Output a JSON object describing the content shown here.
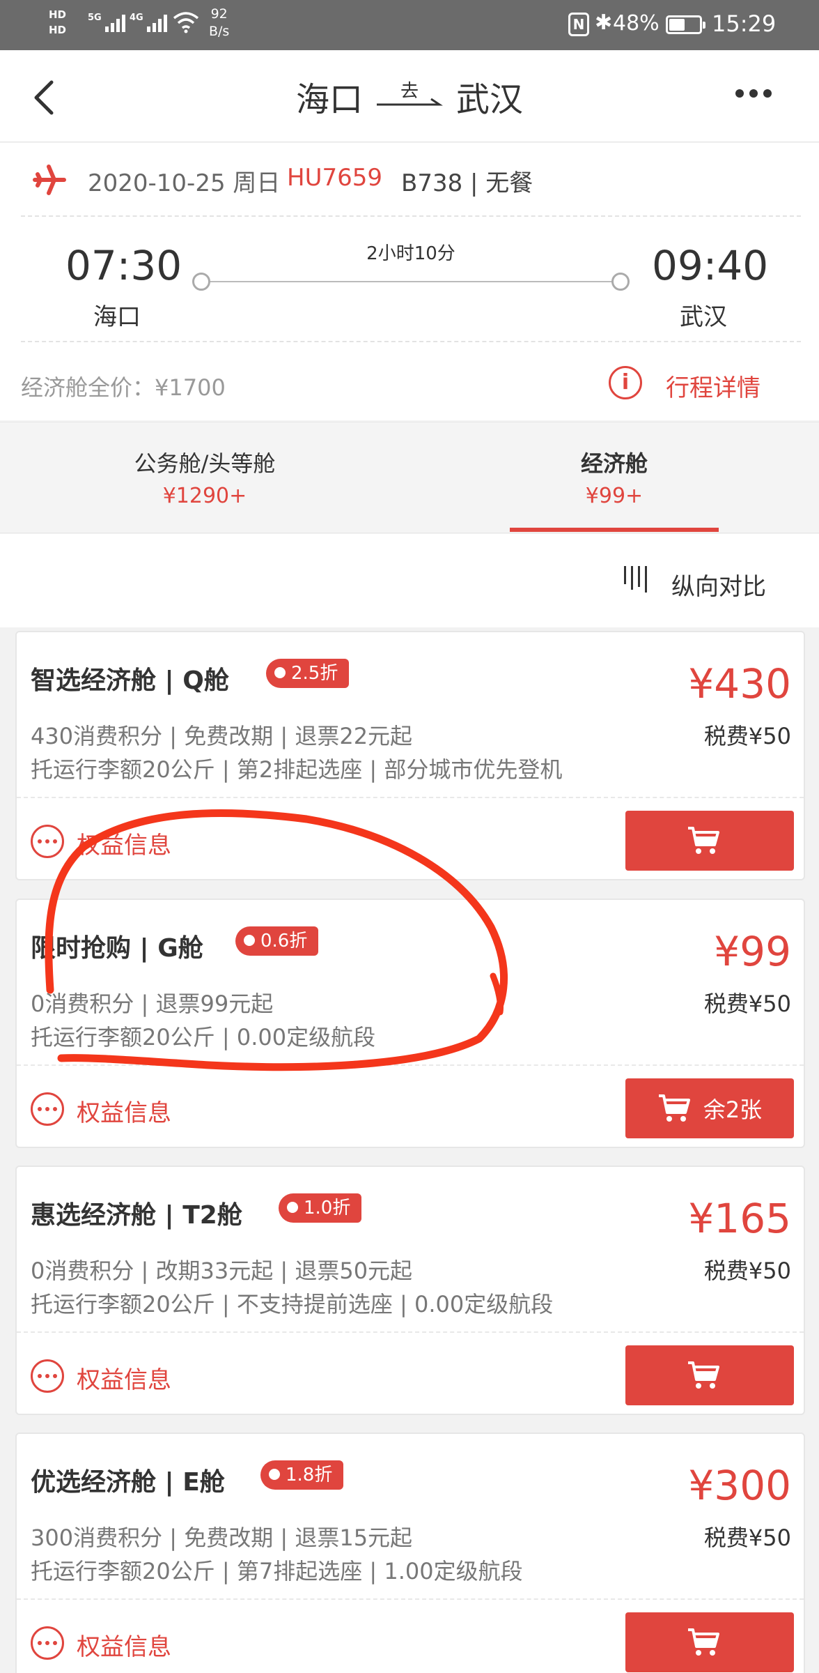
{
  "status_bar": {
    "hd1": "HD",
    "hd2": "HD",
    "net1": "5G",
    "net2": "4G",
    "speed_value": "92",
    "speed_unit": "B/s",
    "nfc": "N",
    "bluetooth": "✱",
    "battery": "48%",
    "time": "15:29"
  },
  "nav": {
    "from": "海口",
    "direction": "去",
    "to": "武汉"
  },
  "flight": {
    "date": "2020-10-25 周日",
    "flight_no": "HU7659",
    "model": "B738 | 无餐",
    "dep_time": "07:30",
    "dep_city": "海口",
    "duration": "2小时10分",
    "arr_time": "09:40",
    "arr_city": "武汉",
    "full_price": "经济舱全价：¥1700",
    "detail_link": "行程详情"
  },
  "tabs": [
    {
      "label": "公务舱/头等舱",
      "price": "¥1290+"
    },
    {
      "label": "经济舱",
      "price": "¥99+"
    }
  ],
  "compare": {
    "label": "纵向对比"
  },
  "fares": [
    {
      "name": "智选经济舱 | Q舱",
      "discount": "2.5折",
      "price": "¥430",
      "tax": "税费¥50",
      "line1": "430消费积分 | 免费改期 | 退票22元起",
      "line2": "托运行李额20公斤 | 第2排起选座 | 部分城市优先登机",
      "benefit": "权益信息",
      "buy_label": ""
    },
    {
      "name": "限时抢购 | G舱",
      "discount": "0.6折",
      "price": "¥99",
      "tax": "税费¥50",
      "line1": "0消费积分 | 退票99元起",
      "line2": "托运行李额20公斤 | 0.00定级航段",
      "benefit": "权益信息",
      "buy_label": "余2张"
    },
    {
      "name": "惠选经济舱 | T2舱",
      "discount": "1.0折",
      "price": "¥165",
      "tax": "税费¥50",
      "line1": "0消费积分 | 改期33元起 | 退票50元起",
      "line2": "托运行李额20公斤 | 不支持提前选座 | 0.00定级航段",
      "benefit": "权益信息",
      "buy_label": ""
    },
    {
      "name": "优选经济舱 | E舱",
      "discount": "1.8折",
      "price": "¥300",
      "tax": "税费¥50",
      "line1": "300消费积分 | 免费改期 | 退票15元起",
      "line2": "托运行李额20公斤 | 第7排起选座 | 1.00定级航段",
      "benefit": "权益信息",
      "buy_label": ""
    }
  ],
  "colors": {
    "accent": "#e0453e",
    "annotation": "#f4361b"
  }
}
